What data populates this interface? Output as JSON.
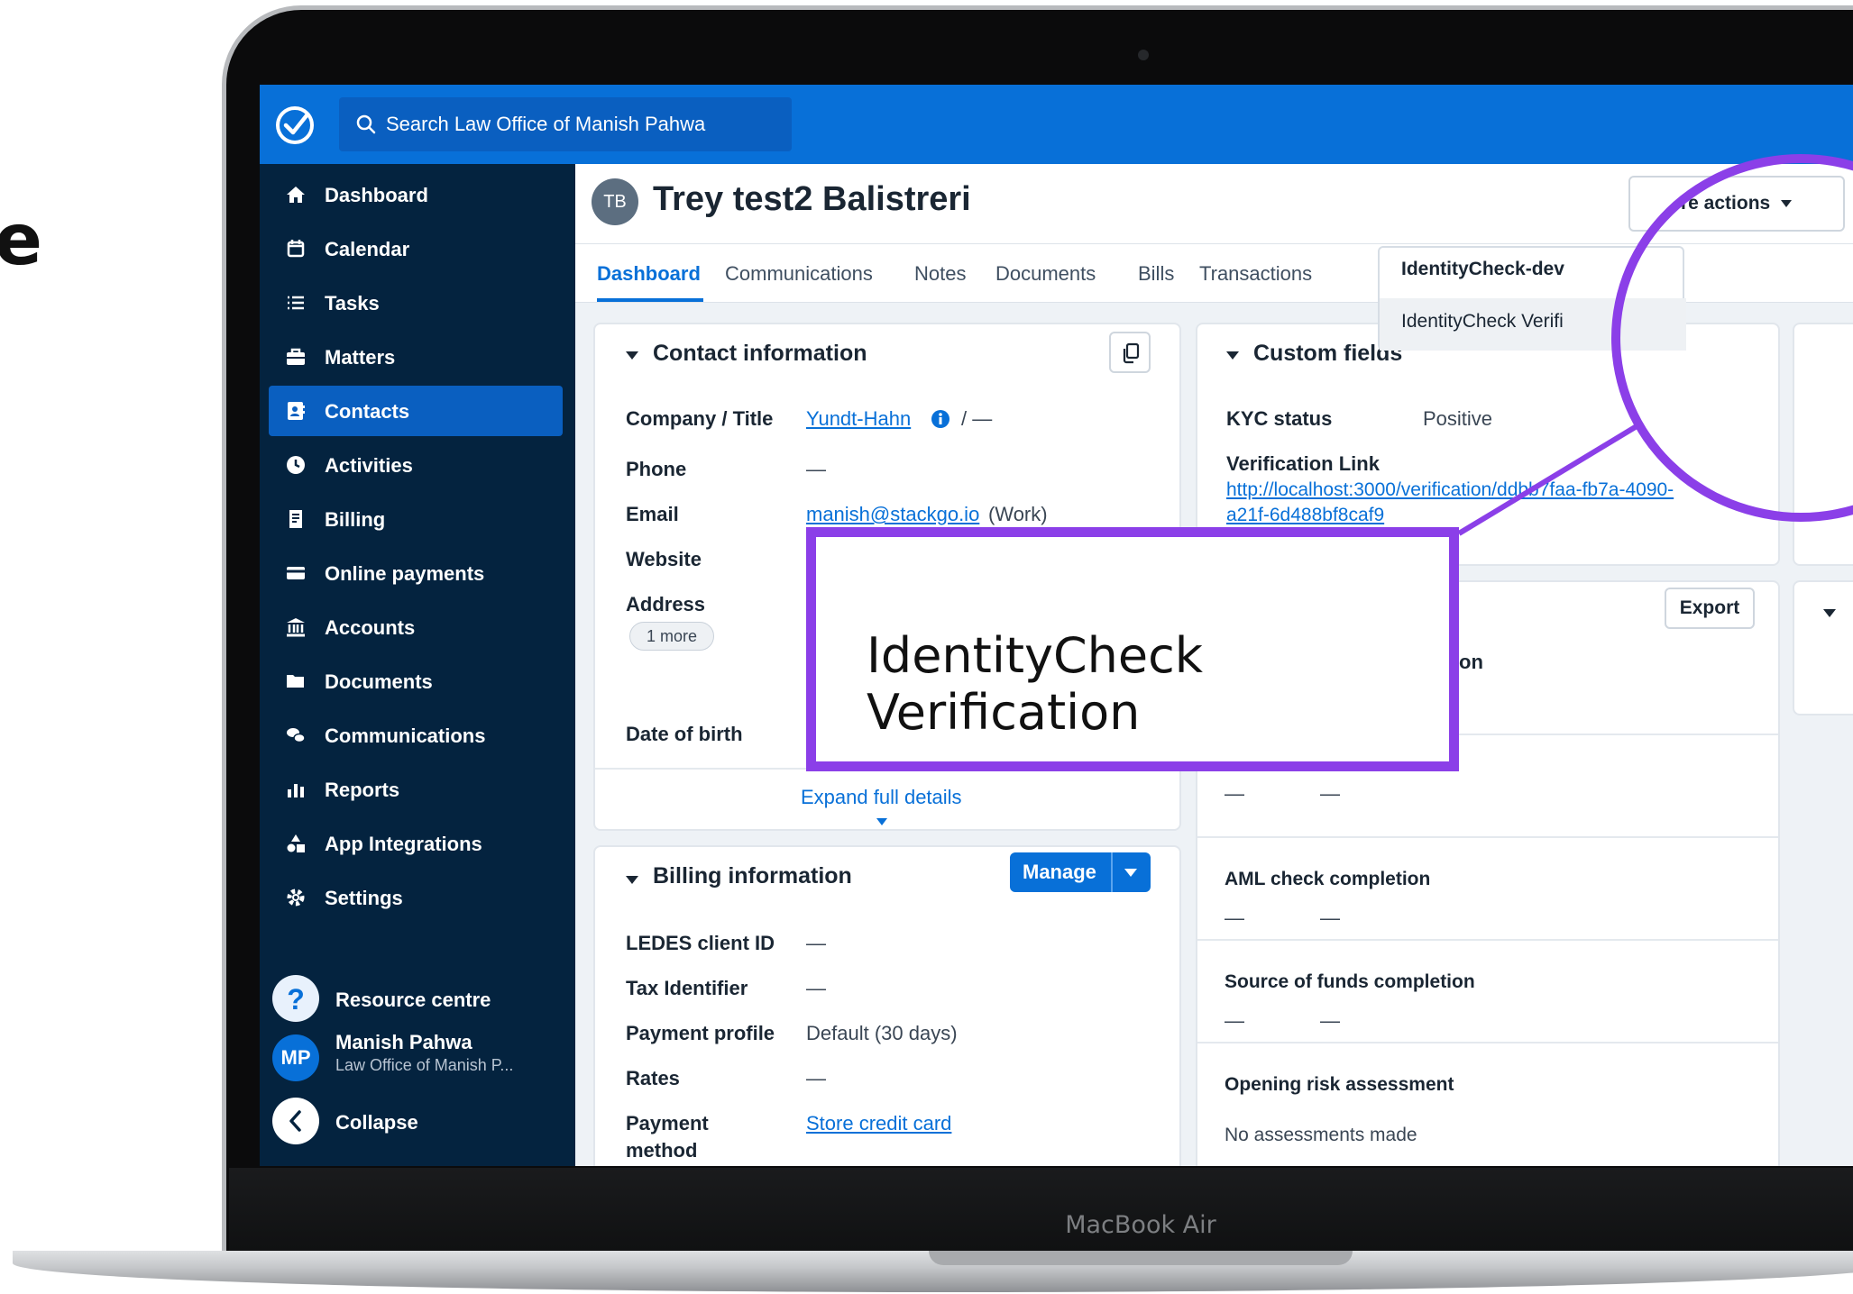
{
  "partial_heading_letter": "e",
  "device_label": "MacBook Air",
  "search": {
    "placeholder": "Search Law Office of Manish Pahwa"
  },
  "sidebar": {
    "items": [
      {
        "label": "Dashboard",
        "icon": "home-icon"
      },
      {
        "label": "Calendar",
        "icon": "calendar-icon"
      },
      {
        "label": "Tasks",
        "icon": "list-icon"
      },
      {
        "label": "Matters",
        "icon": "briefcase-icon"
      },
      {
        "label": "Contacts",
        "icon": "contact-card-icon",
        "active": true
      },
      {
        "label": "Activities",
        "icon": "clock-icon"
      },
      {
        "label": "Billing",
        "icon": "receipt-icon"
      },
      {
        "label": "Online payments",
        "icon": "credit-card-icon"
      },
      {
        "label": "Accounts",
        "icon": "bank-icon"
      },
      {
        "label": "Documents",
        "icon": "folder-icon"
      },
      {
        "label": "Communications",
        "icon": "chat-icon"
      },
      {
        "label": "Reports",
        "icon": "bar-chart-icon"
      },
      {
        "label": "App Integrations",
        "icon": "shapes-icon"
      },
      {
        "label": "Settings",
        "icon": "gear-icon"
      }
    ],
    "resource_centre": "Resource centre",
    "user": {
      "initials": "MP",
      "name": "Manish Pahwa",
      "firm": "Law Office of Manish P..."
    },
    "collapse": "Collapse"
  },
  "contact": {
    "initials": "TB",
    "name": "Trey test2 Balistreri",
    "tabs": [
      "Dashboard",
      "Communications",
      "Notes",
      "Documents",
      "Bills",
      "Transactions"
    ],
    "active_tab": "Dashboard"
  },
  "more_actions": {
    "label": "More actions",
    "visible_label": "re actions",
    "items": [
      "IdentityCheck-dev",
      "IdentityCheck Verifi"
    ]
  },
  "contact_information": {
    "title": "Contact information",
    "company_title_label": "Company / Title",
    "company": "Yundt-Hahn",
    "title_separator": "/ —",
    "phone_label": "Phone",
    "phone": "—",
    "email_label": "Email",
    "email": "manish@stackgo.io",
    "email_type": "(Work)",
    "website_label": "Website",
    "address_label": "Address",
    "address_more": "1 more",
    "dob_label": "Date of birth",
    "expand": "Expand full details"
  },
  "billing_information": {
    "title": "Billing information",
    "manage": "Manage",
    "ledes_label": "LEDES client ID",
    "ledes": "—",
    "tax_label": "Tax Identifier",
    "tax": "—",
    "payment_profile_label": "Payment profile",
    "payment_profile": "Default (30 days)",
    "rates_label": "Rates",
    "rates": "—",
    "payment_method_label_1": "Payment",
    "payment_method_label_2": "method",
    "payment_method": "Store credit card"
  },
  "custom_fields": {
    "title": "Custom fields",
    "kyc_label": "KYC status",
    "kyc": "Positive",
    "verification_link_label": "Verification Link",
    "verification_link_1": "http://localhost:3000/verification/ddbb7faa-fb7a-4090-",
    "verification_link_2": "a21f-6d488bf8caf9"
  },
  "identity_panel": {
    "export": "Export",
    "partial_label": "on",
    "dash": "—",
    "aml_label": "AML check completion",
    "source_funds_label": "Source of funds completion",
    "risk_label": "Opening risk assessment",
    "risk_value": "No assessments made"
  },
  "callout": {
    "text": "IdentityCheck Verification"
  },
  "colors": {
    "brand_blue": "#0870d8",
    "sidebar_navy": "#04233f",
    "highlight_purple": "#8b3fe8"
  }
}
